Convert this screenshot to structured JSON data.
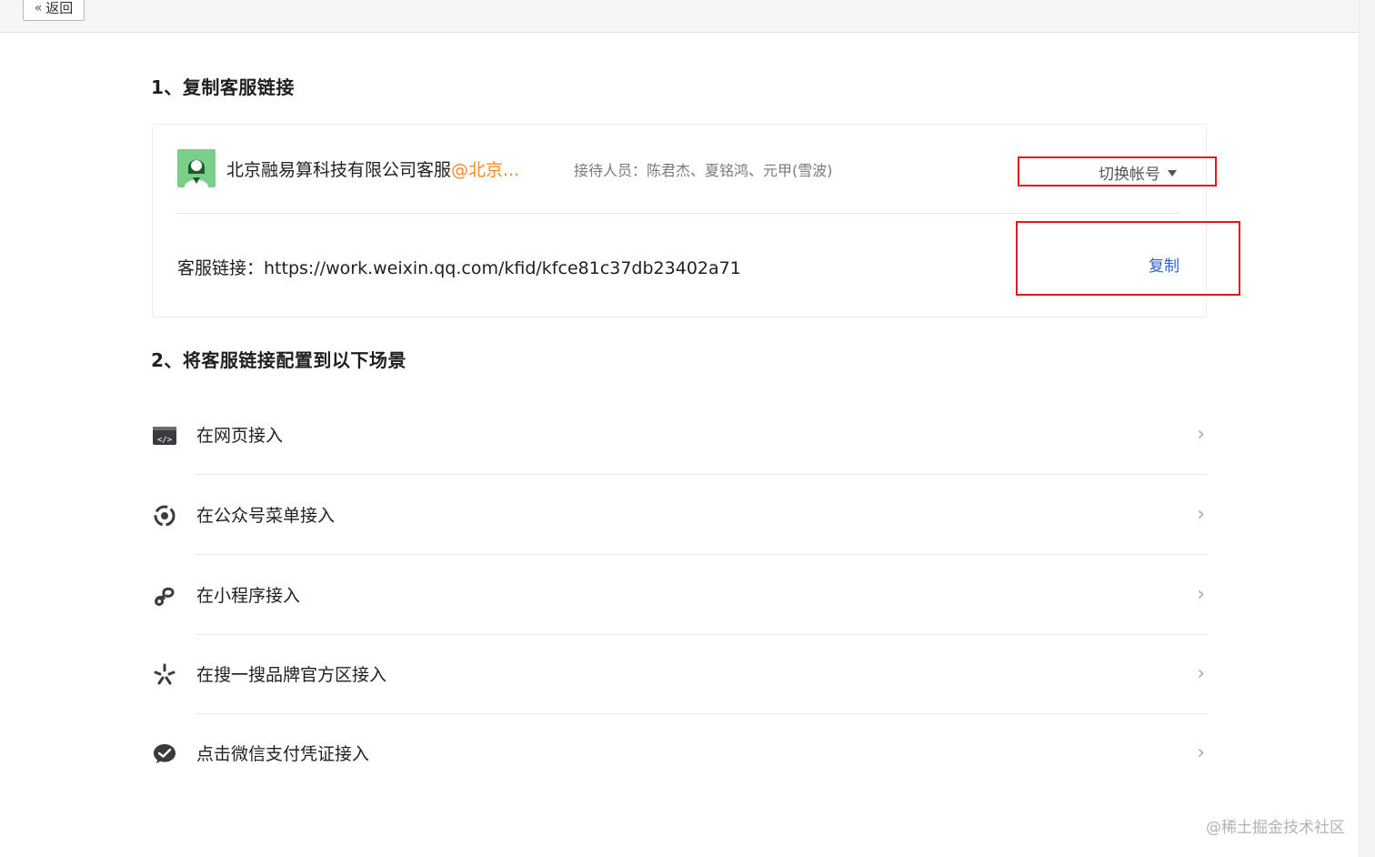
{
  "topbar": {
    "back_icon": "double-chevron-left-icon",
    "back_label": "返回"
  },
  "section1": {
    "title": "1、复制客服链接",
    "account": {
      "name": "北京融易算科技有限公司客服",
      "org_suffix": "@北京...",
      "org_color": "#f08a2b",
      "reception": "接待人员：陈君杰、夏铭鸿、元甲(雪波)",
      "switch_label": "切换帐号",
      "switch_icon": "caret-down-icon"
    },
    "link": {
      "text": "客服链接：https://work.weixin.qq.com/kfid/kfce81c37db23402a71",
      "copy_label": "复制",
      "copy_color": "#2b63c7"
    }
  },
  "section2": {
    "title": "2、将客服链接配置到以下场景",
    "items": [
      {
        "label": "在网页接入",
        "icon": "web-code-icon"
      },
      {
        "label": "在公众号菜单接入",
        "icon": "official-account-icon"
      },
      {
        "label": "在小程序接入",
        "icon": "mini-program-icon"
      },
      {
        "label": "在搜一搜品牌官方区接入",
        "icon": "search-star-icon"
      },
      {
        "label": "点击微信支付凭证接入",
        "icon": "wechat-pay-icon"
      }
    ],
    "arrow_icon": "chevron-right-icon"
  },
  "highlight_color": "#e01b1b",
  "watermark": "@稀土掘金技术社区"
}
